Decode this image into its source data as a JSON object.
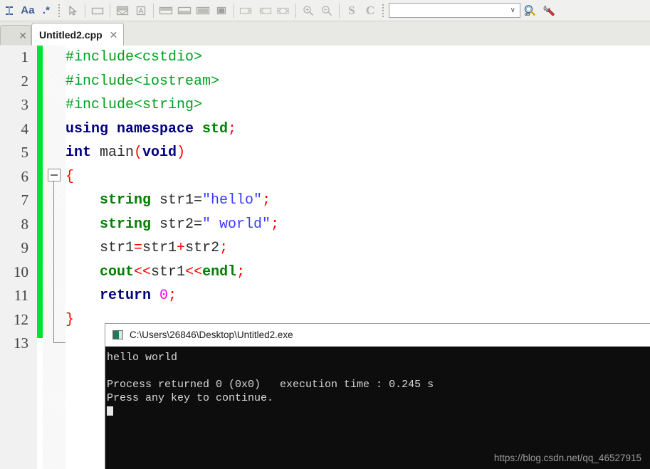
{
  "toolbar": {
    "find_icons": [
      {
        "name": "text-cursor-icon",
        "glyph": "I"
      },
      {
        "name": "match-case-icon",
        "label": "Aa"
      },
      {
        "name": "regex-icon",
        "label": ".*"
      }
    ],
    "tools": [
      {
        "name": "pointer-icon",
        "title": "Select"
      },
      {
        "name": "rectangle-icon",
        "title": "Blank window"
      },
      {
        "name": "split-horizontal-icon",
        "title": "Split horizontal"
      },
      {
        "name": "split-letter-icon",
        "title": "Letter layout"
      },
      {
        "name": "dock-top-icon",
        "title": "Dock top"
      },
      {
        "name": "dock-bottom-icon",
        "title": "Dock bottom"
      },
      {
        "name": "dock-full-icon",
        "title": "Dock full"
      },
      {
        "name": "dock-filled-icon",
        "title": "Dock filled"
      },
      {
        "name": "arrow-right-box-icon",
        "title": "Next"
      },
      {
        "name": "arrow-left-box-icon",
        "title": "Previous"
      },
      {
        "name": "arrow-both-box-icon",
        "title": "Toggle"
      },
      {
        "name": "zoom-in-icon",
        "title": "Zoom in"
      },
      {
        "name": "zoom-out-icon",
        "title": "Zoom out"
      },
      {
        "name": "s-glyph-icon",
        "label": "S"
      },
      {
        "name": "c-glyph-icon",
        "label": "C"
      }
    ],
    "combo": {
      "value": "",
      "placeholder": "",
      "arrow": "∨"
    },
    "search_button": {
      "name": "search-magnifier-icon"
    },
    "settings_button": {
      "name": "wrench-icon"
    }
  },
  "tabs": {
    "partial_tab_close": "✕",
    "active": {
      "title": "Untitled2.cpp",
      "close": "✕"
    }
  },
  "editor": {
    "line_numbers": [
      "1",
      "2",
      "3",
      "4",
      "5",
      "6",
      "7",
      "8",
      "9",
      "10",
      "11",
      "12",
      "13"
    ],
    "fold_marker": "−",
    "lines": [
      [
        {
          "t": "#include<cstdio>",
          "c": "k-pre"
        }
      ],
      [
        {
          "t": "#include<iostream>",
          "c": "k-pre"
        }
      ],
      [
        {
          "t": "#include<string>",
          "c": "k-pre"
        }
      ],
      [
        {
          "t": "using namespace ",
          "c": "k-kw"
        },
        {
          "t": "std",
          "c": "k-type"
        },
        {
          "t": ";",
          "c": "k-op"
        }
      ],
      [
        {
          "t": "int ",
          "c": "k-kw"
        },
        {
          "t": "main",
          "c": "k-plain"
        },
        {
          "t": "(",
          "c": "k-op"
        },
        {
          "t": "void",
          "c": "k-kw"
        },
        {
          "t": ")",
          "c": "k-op"
        }
      ],
      [
        {
          "t": "{",
          "c": "k-op"
        }
      ],
      [
        {
          "t": "    ",
          "c": "k-plain"
        },
        {
          "t": "string",
          "c": "k-type"
        },
        {
          "t": " str1=",
          "c": "k-plain"
        },
        {
          "t": "\"hello\"",
          "c": "k-str"
        },
        {
          "t": ";",
          "c": "k-op"
        }
      ],
      [
        {
          "t": "    ",
          "c": "k-plain"
        },
        {
          "t": "string",
          "c": "k-type"
        },
        {
          "t": " str2=",
          "c": "k-plain"
        },
        {
          "t": "\" world\"",
          "c": "k-str"
        },
        {
          "t": ";",
          "c": "k-op"
        }
      ],
      [
        {
          "t": "    str1",
          "c": "k-plain"
        },
        {
          "t": "=",
          "c": "k-op"
        },
        {
          "t": "str1",
          "c": "k-plain"
        },
        {
          "t": "+",
          "c": "k-op"
        },
        {
          "t": "str2",
          "c": "k-plain"
        },
        {
          "t": ";",
          "c": "k-op"
        }
      ],
      [
        {
          "t": "    ",
          "c": "k-plain"
        },
        {
          "t": "cout",
          "c": "k-type"
        },
        {
          "t": "<<",
          "c": "k-op"
        },
        {
          "t": "str1",
          "c": "k-plain"
        },
        {
          "t": "<<",
          "c": "k-op"
        },
        {
          "t": "endl",
          "c": "k-type"
        },
        {
          "t": ";",
          "c": "k-op"
        }
      ],
      [
        {
          "t": "    ",
          "c": "k-plain"
        },
        {
          "t": "return",
          "c": "k-kw"
        },
        {
          "t": " ",
          "c": "k-plain"
        },
        {
          "t": "0",
          "c": "k-num"
        },
        {
          "t": ";",
          "c": "k-op"
        }
      ],
      [
        {
          "t": "}",
          "c": "k-op"
        }
      ],
      [
        {
          "t": "",
          "c": "k-plain"
        }
      ]
    ]
  },
  "console": {
    "title": "C:\\Users\\26846\\Desktop\\Untitled2.exe",
    "output_lines": [
      "hello world",
      "",
      "Process returned 0 (0x0)   execution time : 0.245 s",
      "Press any key to continue."
    ],
    "watermark": "https://blog.csdn.net/qq_46527915"
  },
  "colors": {
    "modified_bar": "#00e331",
    "preprocessor": "#00a020",
    "keyword": "#000080",
    "type": "#008000",
    "operator": "#ff0000",
    "string": "#3b3bff",
    "number": "#ff00ff",
    "console_bg": "#0d0d0d"
  }
}
